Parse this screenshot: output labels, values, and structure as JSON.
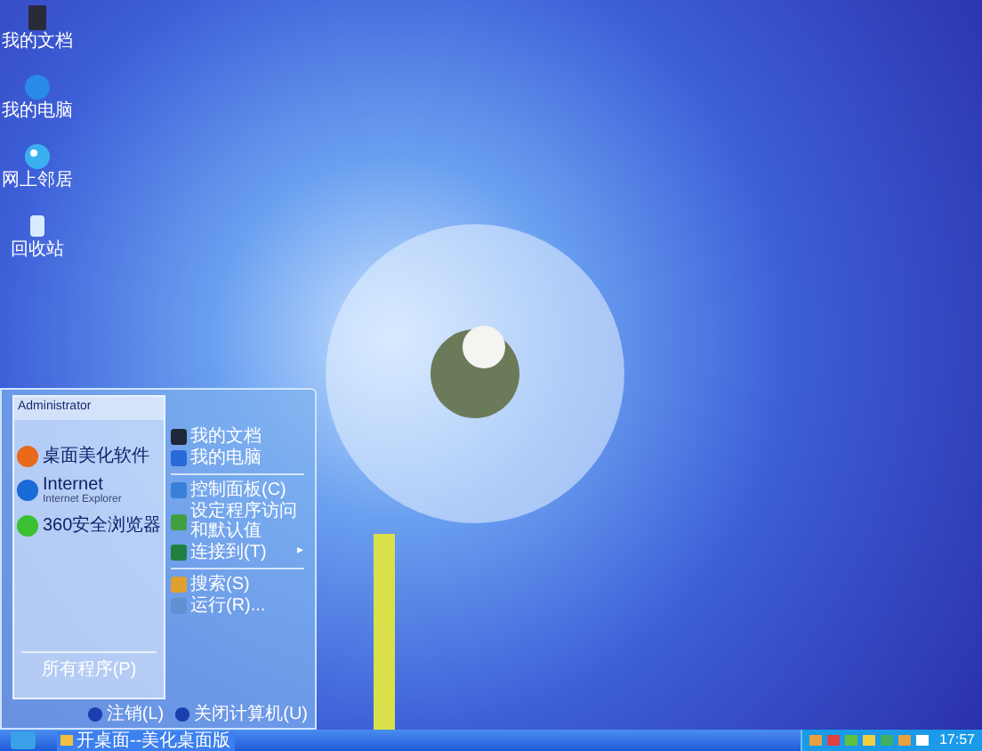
{
  "desktop_icons": [
    {
      "label": "我的文档"
    },
    {
      "label": "我的电脑"
    },
    {
      "label": "网上邻居"
    },
    {
      "label": "回收站"
    }
  ],
  "start_menu": {
    "user": "Administrator",
    "pinned": [
      {
        "title": "桌面美化软件"
      },
      {
        "title": "Internet",
        "subtitle": "Internet Explorer"
      },
      {
        "title": "360安全浏览器"
      }
    ],
    "all_programs": "所有程序(P)",
    "places": [
      {
        "kind": "item",
        "label": "我的文档"
      },
      {
        "kind": "item",
        "label": "我的电脑"
      },
      {
        "kind": "divider"
      },
      {
        "kind": "item",
        "label": "控制面板(C)"
      },
      {
        "kind": "item",
        "label": "设定程序访问和默认值"
      },
      {
        "kind": "item",
        "label": "连接到(T)",
        "arrow": "▸"
      },
      {
        "kind": "divider"
      },
      {
        "kind": "item",
        "label": "搜索(S)"
      },
      {
        "kind": "item",
        "label": "运行(R)..."
      }
    ],
    "log_off": "注销(L)",
    "shut_down": "关闭计算机(U)"
  },
  "taskbar": {
    "tasks": [
      {
        "label": "开桌面--美化桌面版",
        "selected": false
      }
    ],
    "clock": "17:57"
  }
}
